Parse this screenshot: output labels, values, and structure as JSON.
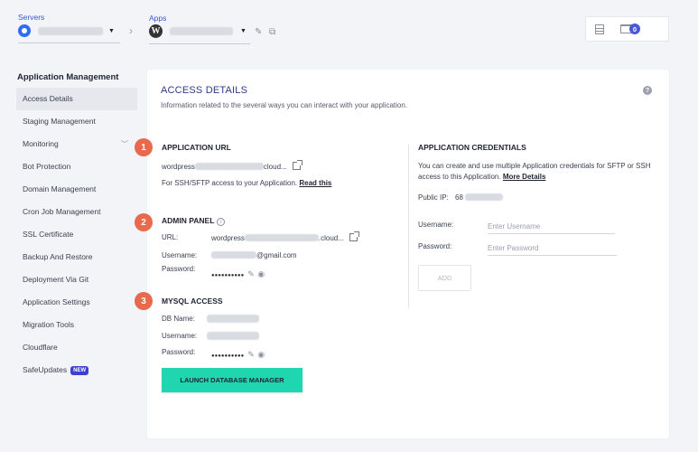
{
  "header": {
    "servers_label": "Servers",
    "apps_label": "Apps",
    "notification_count": "0"
  },
  "sidebar": {
    "title": "Application Management",
    "items": [
      {
        "label": "Access Details"
      },
      {
        "label": "Staging Management"
      },
      {
        "label": "Monitoring"
      },
      {
        "label": "Bot Protection"
      },
      {
        "label": "Domain Management"
      },
      {
        "label": "Cron Job Management"
      },
      {
        "label": "SSL Certificate"
      },
      {
        "label": "Backup And Restore"
      },
      {
        "label": "Deployment Via Git"
      },
      {
        "label": "Application Settings"
      },
      {
        "label": "Migration Tools"
      },
      {
        "label": "Cloudflare"
      },
      {
        "label": "SafeUpdates"
      }
    ],
    "new_badge": "NEW"
  },
  "main": {
    "title": "ACCESS DETAILS",
    "subtitle": "Information related to the several ways you can interact with your application.",
    "help_icon": "?",
    "steps": [
      "1",
      "2",
      "3"
    ],
    "app_url": {
      "heading": "APPLICATION URL",
      "url_prefix": "wordpress",
      "url_suffix": "cloud...",
      "ssh_text": "For SSH/SFTP access to your Application.",
      "read_this": "Read this"
    },
    "admin_panel": {
      "heading": "ADMIN PANEL",
      "url_label": "URL:",
      "url_prefix": "wordpress",
      "url_suffix": ".cloud...",
      "username_label": "Username:",
      "username_suffix": "@gmail.com",
      "password_label": "Password:",
      "password_mask": "●●●●●●●●●●"
    },
    "mysql": {
      "heading": "MYSQL ACCESS",
      "db_label": "DB Name:",
      "username_label": "Username:",
      "password_label": "Password:",
      "password_mask": "●●●●●●●●●●",
      "launch_button": "LAUNCH DATABASE MANAGER"
    },
    "credentials": {
      "heading": "APPLICATION CREDENTIALS",
      "description": "You can create and use multiple Application credentials for SFTP or SSH access to this Application.",
      "more_details": "More Details",
      "public_ip_label": "Public IP:",
      "public_ip_prefix": "68",
      "username_label": "Username:",
      "username_placeholder": "Enter Username",
      "password_label": "Password:",
      "password_placeholder": "Enter Password",
      "add_button": "ADD"
    }
  },
  "colors": {
    "accent": "#3a55d6",
    "step_badge": "#e8694b",
    "launch_button": "#1fd6b0",
    "new_badge": "#3b3fd4"
  }
}
